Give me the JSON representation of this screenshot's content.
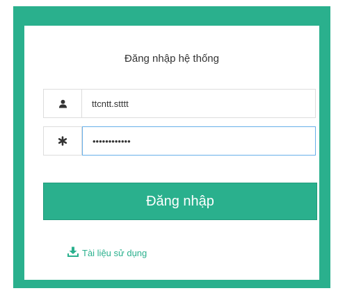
{
  "login": {
    "title": "Đăng nhập hệ thống",
    "username": {
      "value": "ttcntt.stttt",
      "icon": "user-icon"
    },
    "password": {
      "value": "••••••••••••",
      "icon": "asterisk-icon"
    },
    "submit_label": "Đăng nhập",
    "docs_link_label": "Tài liệu sử dụng",
    "docs_link_icon": "download-icon"
  },
  "colors": {
    "primary": "#2ab08d",
    "focus_border": "#66afe9",
    "border": "#dcdcdc"
  }
}
